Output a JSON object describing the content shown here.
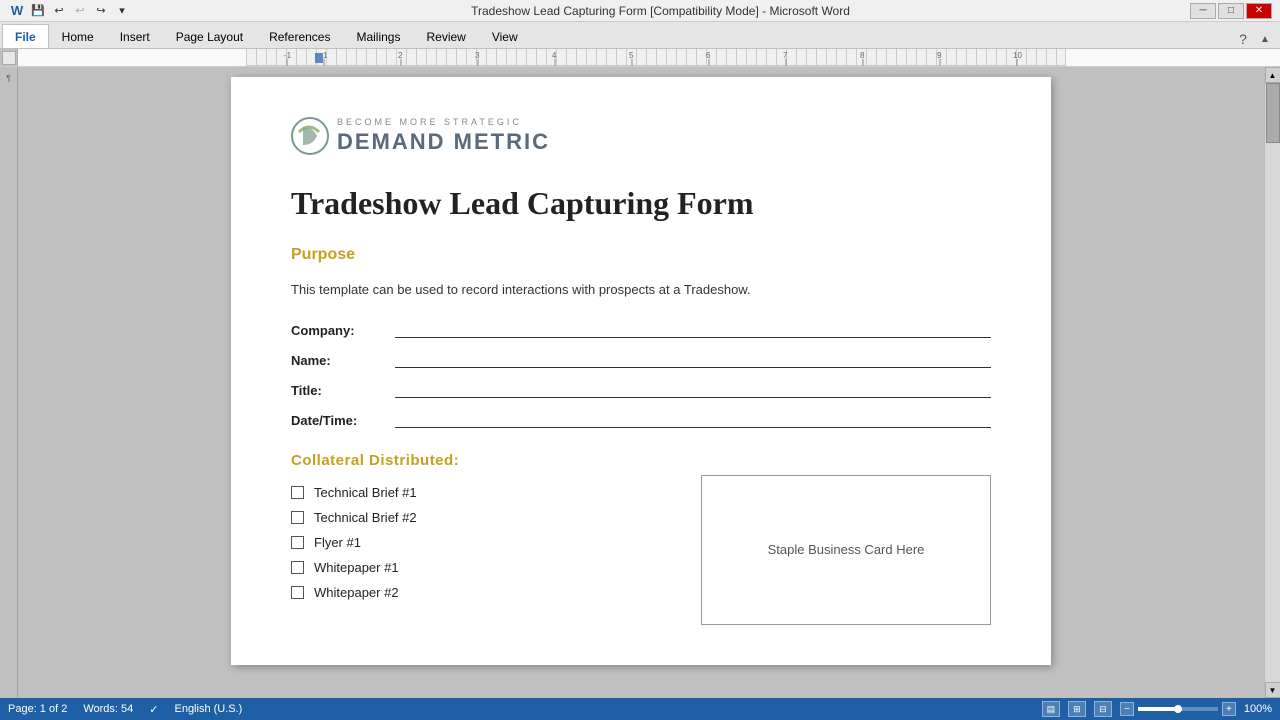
{
  "titlebar": {
    "title": "Tradeshow Lead Capturing Form [Compatibility Mode] - Microsoft Word",
    "min_btn": "─",
    "max_btn": "□",
    "close_btn": "✕"
  },
  "quickaccess": {
    "save_label": "💾",
    "undo_label": "↩",
    "redo_label": "↪",
    "dropdown_label": "▾"
  },
  "ribbon": {
    "tabs": [
      {
        "label": "File",
        "active": true
      },
      {
        "label": "Home"
      },
      {
        "label": "Insert"
      },
      {
        "label": "Page Layout"
      },
      {
        "label": "References"
      },
      {
        "label": "Mailings"
      },
      {
        "label": "Review"
      },
      {
        "label": "View"
      }
    ]
  },
  "logo": {
    "tagline": "Become More Strategic",
    "name": "Demand Metric"
  },
  "document": {
    "title": "Tradeshow Lead Capturing Form",
    "purpose_heading": "Purpose",
    "purpose_text": "This template can be used to record interactions with prospects at a Tradeshow.",
    "fields": [
      {
        "label": "Company:"
      },
      {
        "label": "Name:"
      },
      {
        "label": "Title:"
      },
      {
        "label": "Date/Time:"
      }
    ],
    "collateral_heading": "Collateral  Distributed:",
    "collateral_items": [
      {
        "label": "Technical Brief #1"
      },
      {
        "label": "Technical Brief #2"
      },
      {
        "label": "Flyer #1"
      },
      {
        "label": "Whitepaper #1"
      },
      {
        "label": "Whitepaper #2"
      }
    ],
    "business_card_text": "Staple Business Card Here"
  },
  "statusbar": {
    "page_info": "Page: 1 of 2",
    "words": "Words: 54",
    "language": "English (U.S.)",
    "zoom": "100%"
  }
}
